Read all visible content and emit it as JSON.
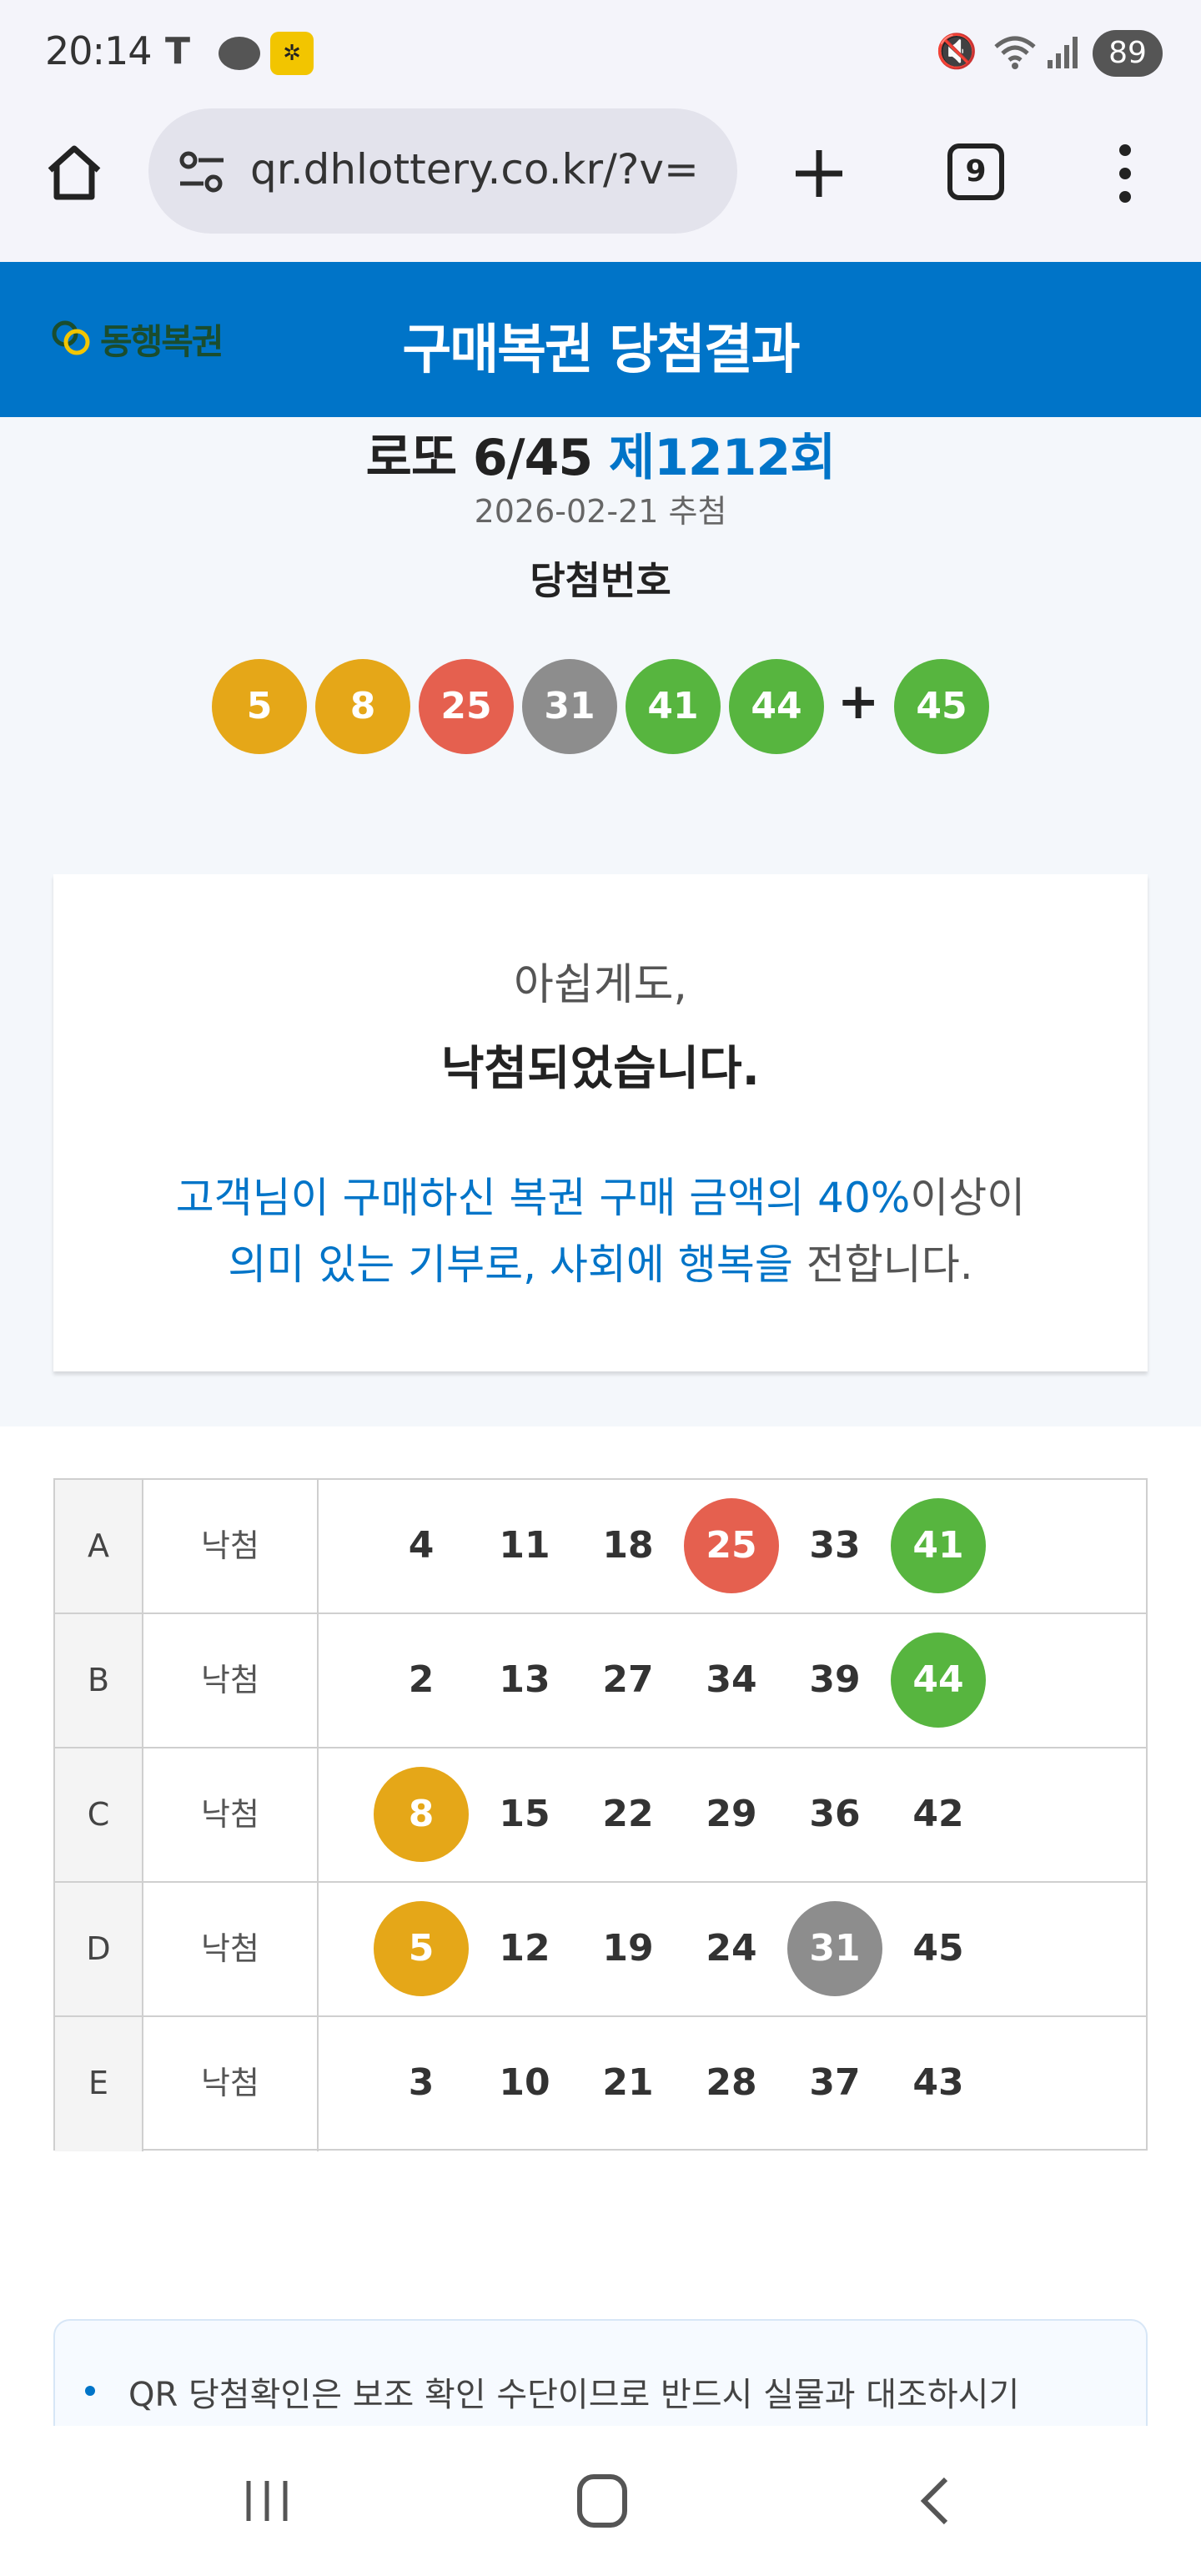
{
  "status_bar": {
    "time": "20:14",
    "carrier_icon": "T",
    "lotto_app_icon": "lotto-icon",
    "battery": "89",
    "icons": [
      "mute-icon",
      "wifi-icon",
      "signal-icon"
    ]
  },
  "browser": {
    "url": "qr.dhlottery.co.kr/?v=",
    "tab_count": "9",
    "icons": [
      "home-icon",
      "tune-icon",
      "new-tab-icon",
      "tabs-icon",
      "more-vert-icon"
    ]
  },
  "header": {
    "logo_text": "동행복권",
    "title": "구매복권 당첨결과"
  },
  "draw": {
    "game_name": "로또 6/45",
    "round": "제1212회",
    "date": "2026-02-21 추첨",
    "winning_label": "당첨번호",
    "numbers": [
      {
        "value": "5",
        "color": "#e5a718"
      },
      {
        "value": "8",
        "color": "#e5a718"
      },
      {
        "value": "25",
        "color": "#e5604f"
      },
      {
        "value": "31",
        "color": "#8d8d8d"
      },
      {
        "value": "41",
        "color": "#57b53f"
      },
      {
        "value": "44",
        "color": "#57b53f"
      }
    ],
    "plus": "+",
    "bonus": {
      "value": "45",
      "color": "#57b53f"
    }
  },
  "message": {
    "line1": "아쉽게도,",
    "line2": "낙첨되었습니다.",
    "line3_blue": "고객님이 구매하신 복권 구매 금액의 40%",
    "line3_plain": "이상이",
    "line4_blue": "의미 있는 기부로, 사회에 행복을",
    "line4_plain": " 전합니다."
  },
  "ticket": {
    "rows": [
      {
        "game": "A",
        "result": "낙첨",
        "numbers": [
          {
            "value": "4"
          },
          {
            "value": "11"
          },
          {
            "value": "18"
          },
          {
            "value": "25",
            "color": "#e5604f"
          },
          {
            "value": "33"
          },
          {
            "value": "41",
            "color": "#57b53f"
          }
        ]
      },
      {
        "game": "B",
        "result": "낙첨",
        "numbers": [
          {
            "value": "2"
          },
          {
            "value": "13"
          },
          {
            "value": "27"
          },
          {
            "value": "34"
          },
          {
            "value": "39"
          },
          {
            "value": "44",
            "color": "#57b53f"
          }
        ]
      },
      {
        "game": "C",
        "result": "낙첨",
        "numbers": [
          {
            "value": "8",
            "color": "#e5a718"
          },
          {
            "value": "15"
          },
          {
            "value": "22"
          },
          {
            "value": "29"
          },
          {
            "value": "36"
          },
          {
            "value": "42"
          }
        ]
      },
      {
        "game": "D",
        "result": "낙첨",
        "numbers": [
          {
            "value": "5",
            "color": "#e5a718"
          },
          {
            "value": "12"
          },
          {
            "value": "19"
          },
          {
            "value": "24"
          },
          {
            "value": "31",
            "color": "#8d8d8d"
          },
          {
            "value": "45"
          }
        ]
      },
      {
        "game": "E",
        "result": "낙첨",
        "numbers": [
          {
            "value": "3"
          },
          {
            "value": "10"
          },
          {
            "value": "21"
          },
          {
            "value": "28"
          },
          {
            "value": "37"
          },
          {
            "value": "43"
          }
        ]
      }
    ]
  },
  "notice": {
    "text": "QR 당첨확인은 보조 확인 수단이므로 반드시 실물과 대조하시기"
  },
  "nav": {
    "icons": [
      "recent-apps-icon",
      "home-nav-icon",
      "back-icon"
    ]
  }
}
